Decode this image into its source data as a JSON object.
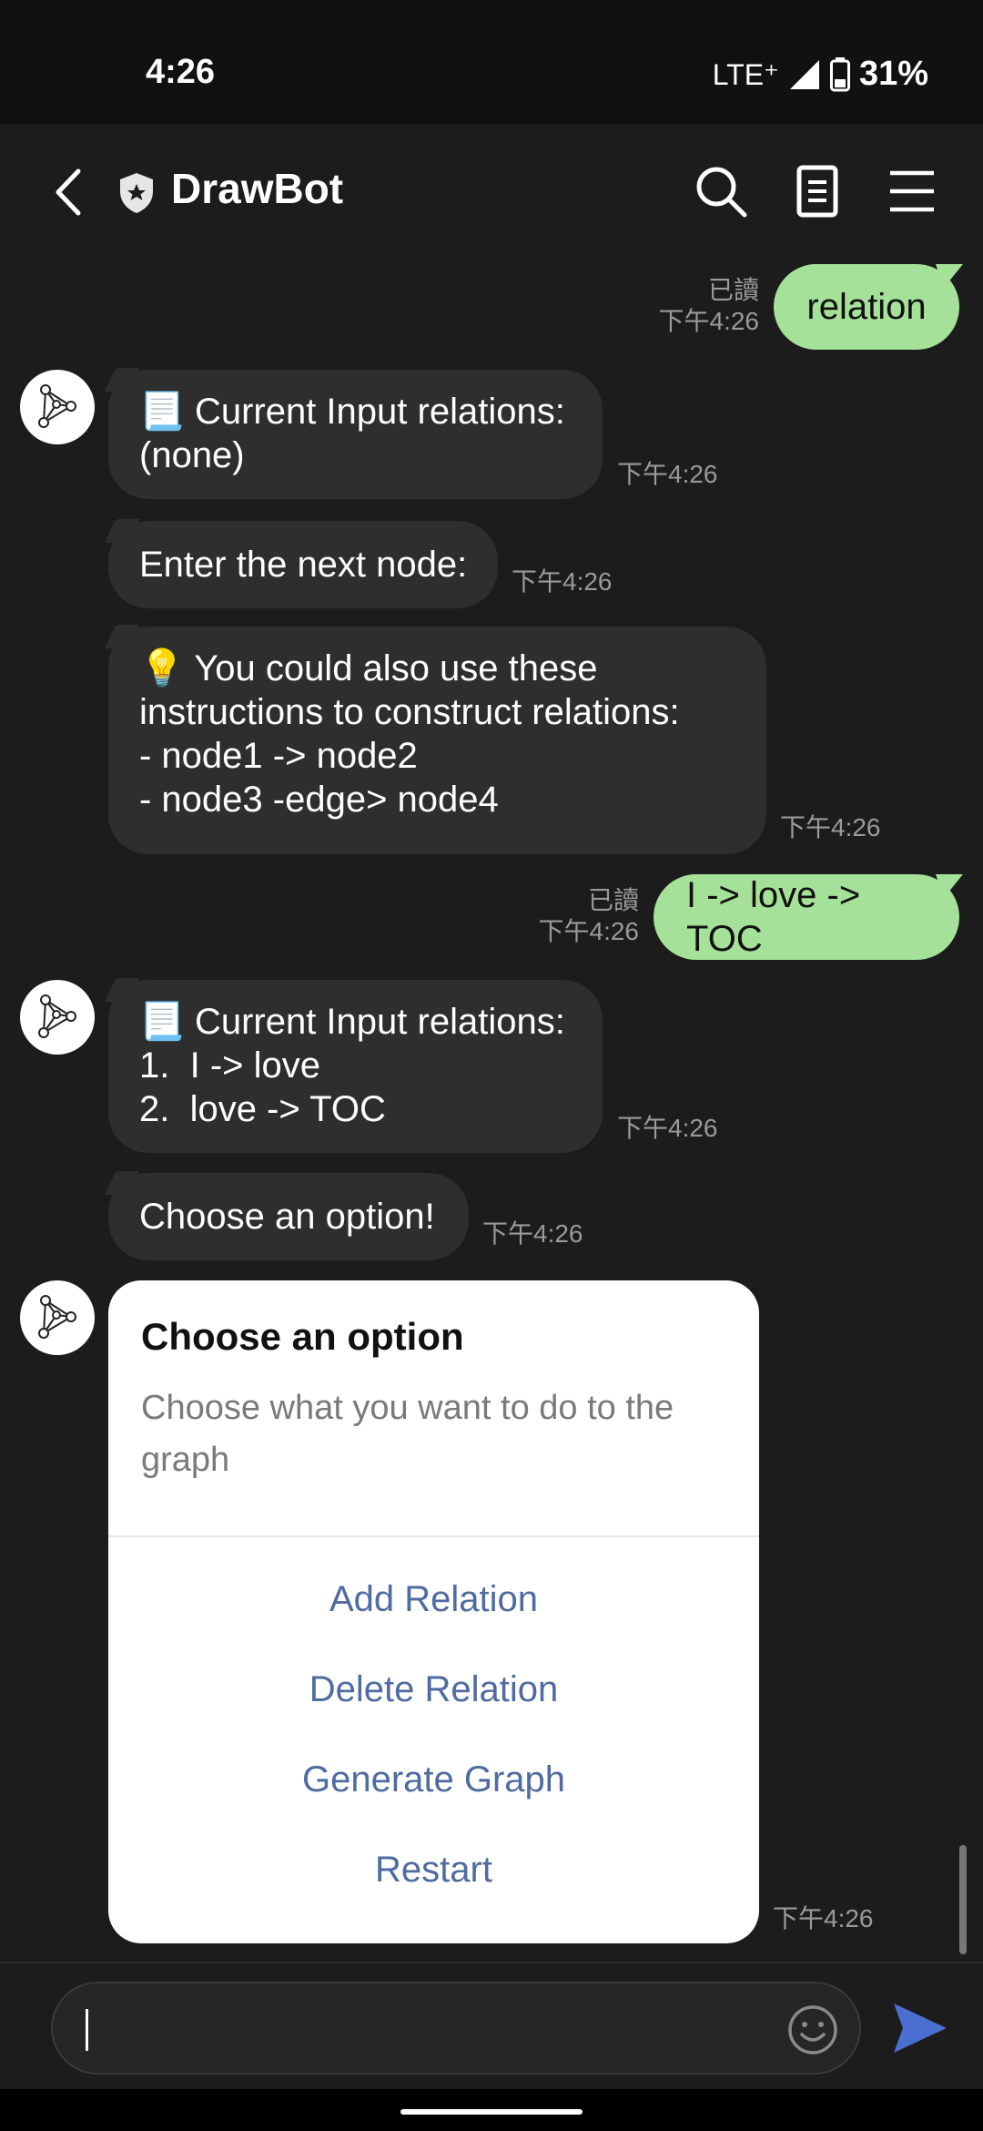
{
  "status_bar": {
    "time": "4:26",
    "network": "LTE⁺",
    "battery": "31%"
  },
  "header": {
    "title": "DrawBot"
  },
  "messages": {
    "m1": {
      "text": "relation",
      "read": "已讀",
      "time": "下午4:26"
    },
    "m2": {
      "line1": "Current Input relations:",
      "line2": "(none)",
      "time": "下午4:26"
    },
    "m3": {
      "text": "Enter the next node:",
      "time": "下午4:26"
    },
    "m4": {
      "line1": "You could also use these",
      "line2": "instructions to construct relations:",
      "line3": "- node1 -> node2",
      "line4": "- node3 -edge> node4",
      "time": "下午4:26"
    },
    "m5": {
      "text": "I -> love -> TOC",
      "read": "已讀",
      "time": "下午4:26"
    },
    "m6": {
      "line1": "Current Input relations:",
      "line2": "1.  I -> love",
      "line3": "2.  love -> TOC",
      "time": "下午4:26"
    },
    "m7": {
      "text": "Choose an option!",
      "time": "下午4:26"
    }
  },
  "card": {
    "title": "Choose an option",
    "description": "Choose what you want to do to the graph",
    "actions": [
      "Add Relation",
      "Delete Relation",
      "Generate Graph",
      "Restart"
    ],
    "time": "下午4:26"
  },
  "input": {
    "value": "",
    "placeholder": ""
  },
  "icons": {
    "scroll": "scroll-icon",
    "bulb": "lightbulb-icon",
    "avatar": "graph-bot-avatar"
  },
  "colors": {
    "my_bubble": "#a6e19a",
    "bot_bubble": "#2e2e2e",
    "action": "#4f6ba0",
    "send": "#4a6fd1"
  }
}
